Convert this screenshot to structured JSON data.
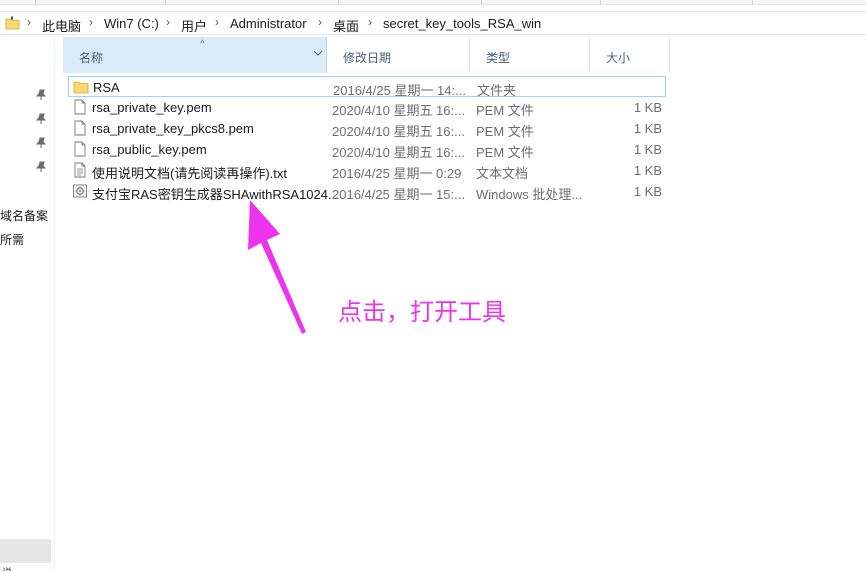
{
  "address_bar": {
    "parts": [
      "此电脑",
      "Win7 (C:)",
      "用户",
      "Administrator",
      "桌面",
      "secret_key_tools_RSA_win"
    ],
    "separator": "›"
  },
  "nav_pane": {
    "items": [
      "域名备案",
      "所需"
    ],
    "bottom_text": "说"
  },
  "columns": {
    "name": "名称",
    "date": "修改日期",
    "type": "类型",
    "size": "大小",
    "sort_indicator": "^"
  },
  "files": [
    {
      "icon": "folder-icon",
      "name": "RSA",
      "date": "2016/4/25 星期一 14:...",
      "type": "文件夹",
      "size": ""
    },
    {
      "icon": "document-icon",
      "name": "rsa_private_key.pem",
      "date": "2020/4/10 星期五 16:...",
      "type": "PEM 文件",
      "size": "1 KB"
    },
    {
      "icon": "document-icon",
      "name": "rsa_private_key_pkcs8.pem",
      "date": "2020/4/10 星期五 16:...",
      "type": "PEM 文件",
      "size": "1 KB"
    },
    {
      "icon": "document-icon",
      "name": "rsa_public_key.pem",
      "date": "2020/4/10 星期五 16:...",
      "type": "PEM 文件",
      "size": "1 KB"
    },
    {
      "icon": "text-file-icon",
      "name": "使用说明文档(请先阅读再操作).txt",
      "date": "2016/4/25 星期一 0:29",
      "type": "文本文档",
      "size": "1 KB"
    },
    {
      "icon": "batch-file-icon",
      "name": "支付宝RAS密钥生成器SHAwithRSA1024...",
      "date": "2016/4/25 星期一 15:...",
      "type": "Windows 批处理...",
      "size": "1 KB"
    }
  ],
  "annotation": {
    "text": "点击，打开工具",
    "color": "#ee33ee"
  },
  "colors": {
    "header_selected": "#d9ebf9",
    "row_focus_border": "#99d1ff",
    "header_text": "#4c607a",
    "folder": "#f8d775"
  }
}
